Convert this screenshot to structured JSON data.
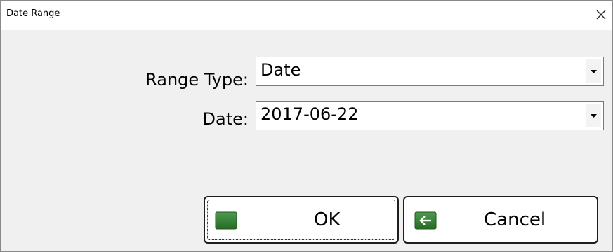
{
  "window": {
    "title": "Date Range"
  },
  "form": {
    "range_type": {
      "label": "Range Type:",
      "value": "Date"
    },
    "date": {
      "label": "Date:",
      "value": "2017-06-22"
    }
  },
  "buttons": {
    "ok_label": "OK",
    "cancel_label": "Cancel"
  },
  "icons": {
    "close": "close-icon",
    "dropdown": "chevron-down-icon",
    "ok": "ok-icon",
    "cancel": "back-arrow-icon"
  },
  "colors": {
    "icon_green": "#2f7f2f",
    "icon_green_light": "#5aa55a"
  }
}
